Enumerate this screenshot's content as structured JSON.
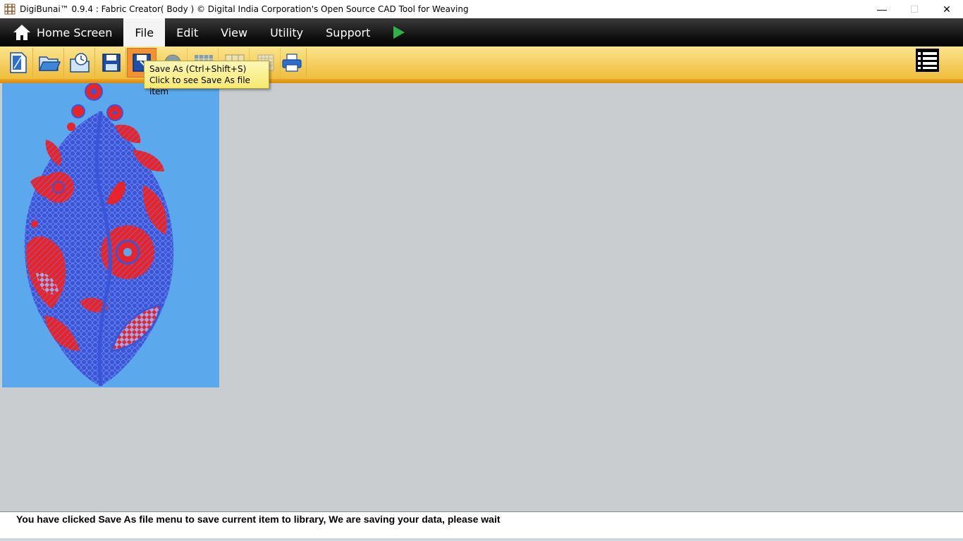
{
  "window": {
    "title": "DigiBunai™ 0.9.4 : Fabric Creator( Body ) © Digital India Corporation's Open Source CAD Tool for Weaving",
    "minimize": "—",
    "maximize": "☐",
    "close": "✕"
  },
  "menu": {
    "home": "Home Screen",
    "file": "File",
    "edit": "Edit",
    "view": "View",
    "utility": "Utility",
    "support": "Support"
  },
  "tooltip": {
    "line1": "Save As (Ctrl+Shift+S)",
    "line2": "Click to see Save As file item"
  },
  "status": {
    "message": "You have clicked Save As file menu to save current item to library, We are saving your data, please wait"
  },
  "colors": {
    "canvas_bg": "#5ba8ec",
    "motif_red": "#e8242a",
    "motif_blue": "#3b55d8",
    "toolbar": "#f4cc5a",
    "workspace": "#c9cdcf"
  }
}
